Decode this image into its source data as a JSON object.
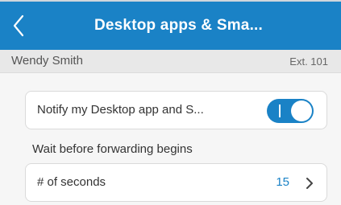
{
  "header": {
    "title": "Desktop apps & Sma...",
    "back_icon": "chevron-left-icon",
    "background": "#1a82c6"
  },
  "user": {
    "name": "Wendy Smith",
    "extension": "Ext. 101"
  },
  "notify": {
    "label": "Notify my Desktop app and S...",
    "toggle_on": true,
    "accent": "#1a82c6"
  },
  "forwarding": {
    "section_label": "Wait before forwarding begins",
    "seconds_label": "# of seconds",
    "seconds_value": "15",
    "chevron_icon": "chevron-right-icon"
  }
}
